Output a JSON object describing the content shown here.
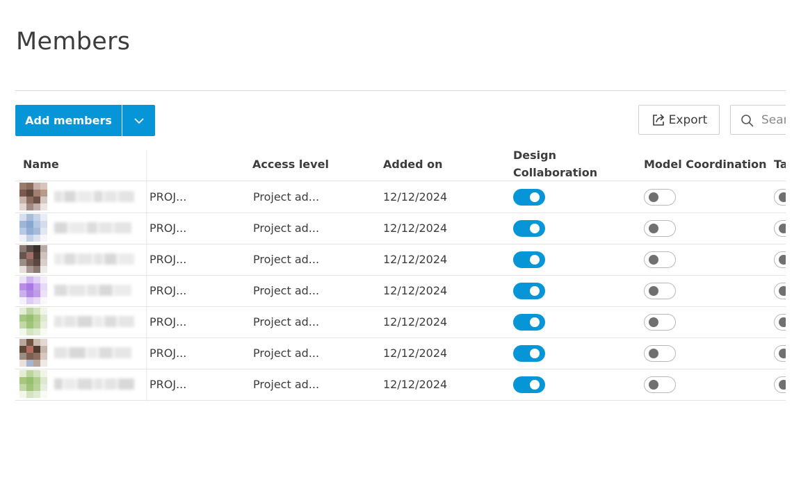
{
  "page": {
    "title": "Members"
  },
  "toolbar": {
    "add_members_label": "Add members",
    "export_label": "Export",
    "search_placeholder": "Search"
  },
  "table": {
    "headers": {
      "name": "Name",
      "company": "",
      "access": "Access level",
      "added": "Added on",
      "design_line1": "Design",
      "design_line2": "Collaboration",
      "model": "Model Coordination",
      "takeoff": "Takeoff"
    },
    "rows": [
      {
        "avatar": [
          "#9c7a6b",
          "#8a6a5c",
          "#c9b1a7",
          "#d9c4bd",
          "#7a5a4d",
          "#5b4438",
          "#a07f70",
          "#b8998a",
          "#c7b3ab",
          "#8c6c5f",
          "#6e5246",
          "#d6c8c2",
          "#e2d6d1",
          "#9e8a82",
          "#bfaea7",
          "#ece6e3"
        ],
        "company": "PROJ...",
        "access": "Project ad...",
        "added": "12/12/2024",
        "design": true,
        "model": false,
        "takeoff": false
      },
      {
        "avatar": [
          "#d5dfee",
          "#a9bcd9",
          "#c7d4e8",
          "#e8eef6",
          "#9fb5d6",
          "#8aa6d0",
          "#b5c7e2",
          "#d1dcec",
          "#b8c9e3",
          "#93aed4",
          "#a5bbdb",
          "#dfe7f2",
          "#eef2f8",
          "#c3d1e6",
          "#dbe4f0",
          "#f4f6fa"
        ],
        "company": "PROJ...",
        "access": "Project ad...",
        "added": "12/12/2024",
        "design": true,
        "model": false,
        "takeoff": false
      },
      {
        "avatar": [
          "#8a7872",
          "#5c4a44",
          "#3a2f2c",
          "#b9aaa5",
          "#6a554e",
          "#a0706a",
          "#4b3935",
          "#cfc2bd",
          "#9d8d88",
          "#7a5f57",
          "#5a4741",
          "#d8cfcb",
          "#e6dfdc",
          "#a99893",
          "#8b7873",
          "#f0ebe9"
        ],
        "company": "PROJ...",
        "access": "Project ad...",
        "added": "12/12/2024",
        "design": true,
        "model": false,
        "takeoff": false
      },
      {
        "avatar": [
          "#ece2f8",
          "#cdb3f0",
          "#e0d0f6",
          "#f4eefb",
          "#b98ee8",
          "#a879e2",
          "#c6a4ee",
          "#e6d9f7",
          "#cbb0ef",
          "#b185e6",
          "#c09be9",
          "#ebe1f8",
          "#f5f0fc",
          "#dccbf4",
          "#e8dcf8",
          "#faf7fd"
        ],
        "company": "PROJ...",
        "access": "Project ad...",
        "added": "12/12/2024",
        "design": true,
        "model": false,
        "takeoff": false
      },
      {
        "avatar": [
          "#e3edd6",
          "#bcd49e",
          "#d2e2bd",
          "#eff5e7",
          "#a6c780",
          "#98bf6f",
          "#b3cf90",
          "#dce9cc",
          "#c2d9a7",
          "#a0c478",
          "#b9d39a",
          "#e6efdb",
          "#f2f7ec",
          "#d4e4c0",
          "#e0ecd2",
          "#f8fbf4"
        ],
        "company": "PROJ...",
        "access": "Project ad...",
        "added": "12/12/2024",
        "design": true,
        "model": false,
        "takeoff": false
      },
      {
        "avatar": [
          "#b8a79d",
          "#6d5546",
          "#c9b8ad",
          "#e3d9d2",
          "#5c4638",
          "#b36b62",
          "#4e3a2e",
          "#c7b5a8",
          "#9e8c80",
          "#7a6152",
          "#8c6d5e",
          "#d7c9bf",
          "#e8e1dc",
          "#a8b5cf",
          "#b7a59a",
          "#efe9e5"
        ],
        "company": "PROJ...",
        "access": "Project ad...",
        "added": "12/12/2024",
        "design": true,
        "model": false,
        "takeoff": false
      },
      {
        "avatar": [
          "#e3edd6",
          "#bcd49e",
          "#d2e2bd",
          "#eff5e7",
          "#a6c780",
          "#98bf6f",
          "#b3cf90",
          "#dce9cc",
          "#c2d9a7",
          "#a0c478",
          "#b9d39a",
          "#e6efdb",
          "#f2f7ec",
          "#d4e4c0",
          "#e0ecd2",
          "#f8fbf4"
        ],
        "company": "PROJ...",
        "access": "Project ad...",
        "added": "12/12/2024",
        "design": true,
        "model": false,
        "takeoff": false
      }
    ]
  }
}
